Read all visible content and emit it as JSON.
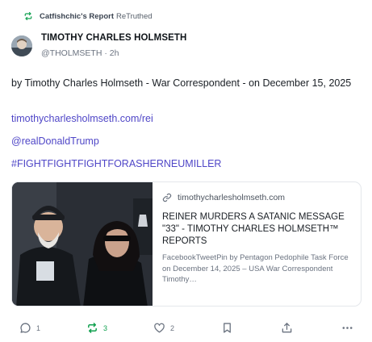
{
  "retruth_banner": {
    "user": "Catfishchic's Report",
    "action": "ReTruthed"
  },
  "post": {
    "author_name": "TIMOTHY CHARLES HOLMSETH",
    "handle": "@THOLMSETH",
    "time": "2h",
    "body": "by Timothy Charles Holmseth - War Correspondent - on December 15, 2025",
    "links": [
      "timothycharlesholmseth.com/rei",
      "@realDonaldTrump",
      "#FIGHTFIGHTFIGHTFORASHERNEUMILLER"
    ]
  },
  "card": {
    "domain": "timothycharlesholmseth.com",
    "title": "REINER MURDERS A SATANIC MESSAGE \"33\" - TIMOTHY CHARLES HOLMSETH™ Reports",
    "description": "FacebookTweetPin by Pentagon Pedophile Task Force on December 14, 2025 – USA War Correspondent Timothy…"
  },
  "actions": {
    "reply_count": "1",
    "retruth_count": "3",
    "like_count": "2"
  },
  "colors": {
    "link": "#4f46c7",
    "retruth_green": "#12a150",
    "muted": "#6b7380"
  },
  "icons": [
    "retruth-icon",
    "link-icon",
    "reply-icon",
    "like-icon",
    "bookmark-icon",
    "share-icon",
    "more-icon"
  ]
}
